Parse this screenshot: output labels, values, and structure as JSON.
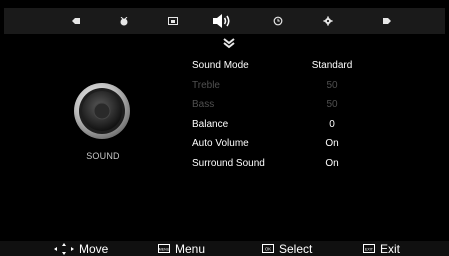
{
  "tabs": [
    {
      "icon": "picture-icon"
    },
    {
      "icon": "channel-icon"
    },
    {
      "icon": "screen-icon"
    },
    {
      "icon": "sound-icon",
      "active": true
    },
    {
      "icon": "clock-icon"
    },
    {
      "icon": "setup-icon"
    },
    {
      "icon": "lock-icon"
    }
  ],
  "page": {
    "label": "SOUND",
    "icon": "speaker-icon"
  },
  "settings": [
    {
      "label": "Sound Mode",
      "value": "Standard",
      "enabled": true
    },
    {
      "label": "Treble",
      "value": "50",
      "enabled": false
    },
    {
      "label": "Bass",
      "value": "50",
      "enabled": false
    },
    {
      "label": "Balance",
      "value": "0",
      "enabled": true
    },
    {
      "label": "Auto Volume",
      "value": "On",
      "enabled": true
    },
    {
      "label": "Surround Sound",
      "value": "On",
      "enabled": true
    }
  ],
  "footer": {
    "move_label": "Move",
    "menu_label": "Menu",
    "menu_key": "MENU",
    "select_label": "Select",
    "select_key": "OK",
    "exit_label": "Exit",
    "exit_key": "EXIT"
  },
  "colors": {
    "background": "#000000",
    "text": "#ffffff",
    "disabled_text": "#505050",
    "bar": "#1a1a1a"
  }
}
